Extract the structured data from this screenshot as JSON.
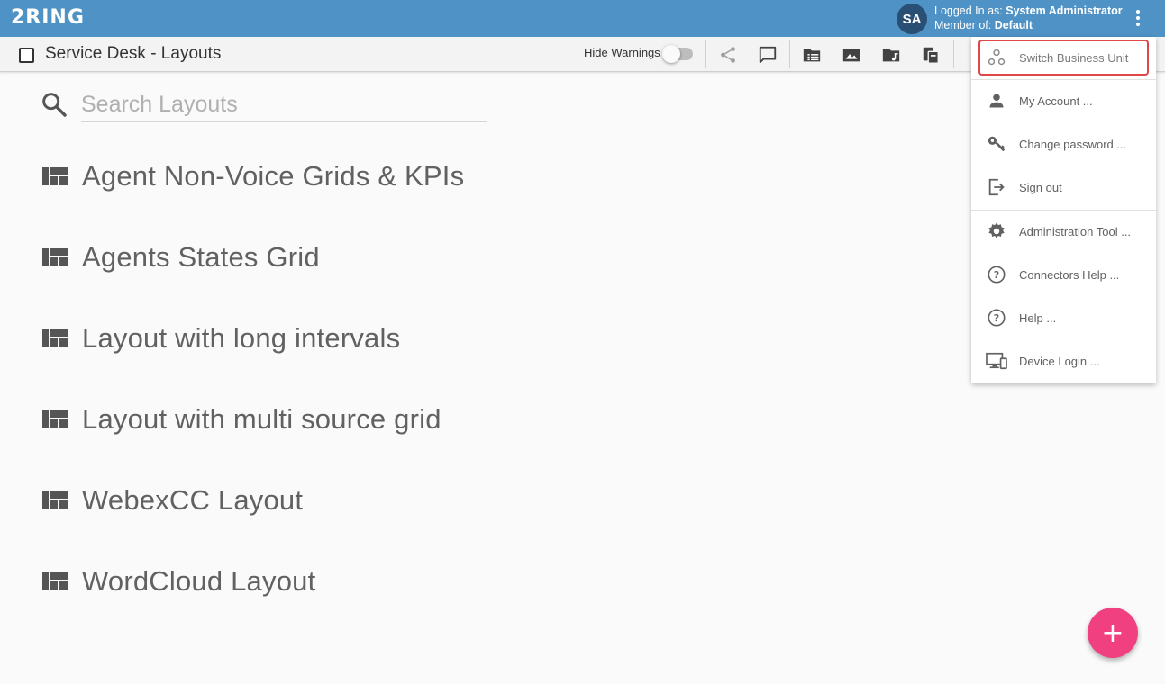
{
  "header": {
    "logo": "2RING",
    "avatar_initials": "SA",
    "logged_in_prefix": "Logged In as: ",
    "logged_in_user": "System Administrator",
    "member_prefix": "Member of: ",
    "member_group": "Default"
  },
  "toolbar": {
    "title": "Service Desk - Layouts",
    "hide_warnings_label": "Hide Warnings",
    "hide_warnings_on": false,
    "icons": [
      "share-icon",
      "comment-icon",
      "folder-list-icon",
      "image-icon",
      "folder-music-icon",
      "copy-icon"
    ]
  },
  "search": {
    "placeholder": "Search Layouts",
    "value": ""
  },
  "layouts": [
    "Agent Non-Voice Grids & KPIs",
    "Agents States Grid",
    "Layout with long intervals",
    "Layout with multi source grid",
    "WebexCC Layout",
    "WordCloud Layout"
  ],
  "menu": {
    "items": [
      {
        "label": "Switch Business Unit",
        "icon": "business-unit-icon"
      },
      {
        "label": "My Account ...",
        "icon": "person-icon"
      },
      {
        "label": "Change password ...",
        "icon": "key-icon"
      },
      {
        "label": "Sign out",
        "icon": "sign-out-icon"
      },
      {
        "label": "Administration Tool ...",
        "icon": "gear-icon"
      },
      {
        "label": "Connectors Help ...",
        "icon": "help-icon"
      },
      {
        "label": "Help ...",
        "icon": "help-icon"
      },
      {
        "label": "Device Login ...",
        "icon": "device-icon"
      }
    ]
  },
  "fab": {
    "label": "+"
  },
  "colors": {
    "appbar": "#4f93c6",
    "avatar": "#2a4f74",
    "fab": "#f0407f",
    "highlight": "#e04848"
  }
}
